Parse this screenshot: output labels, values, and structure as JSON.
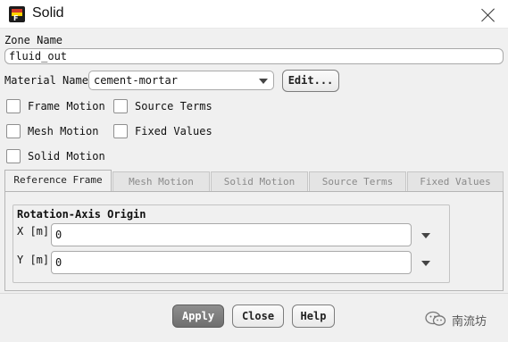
{
  "window": {
    "title": "Solid",
    "icon": "fluent-app-icon",
    "icon_letter": "F"
  },
  "zone": {
    "label": "Zone Name",
    "value": "fluid_out"
  },
  "material": {
    "label": "Material Name",
    "value": "cement-mortar",
    "edit_label": "Edit..."
  },
  "checkboxes": [
    {
      "label": "Frame Motion",
      "checked": false
    },
    {
      "label": "Source Terms",
      "checked": false
    },
    {
      "label": "Mesh Motion",
      "checked": false
    },
    {
      "label": "Fixed Values",
      "checked": false
    },
    {
      "label": "Solid Motion",
      "checked": false
    }
  ],
  "tabs": [
    {
      "label": "Reference Frame",
      "active": true
    },
    {
      "label": "Mesh Motion",
      "active": false
    },
    {
      "label": "Solid Motion",
      "active": false
    },
    {
      "label": "Source Terms",
      "active": false
    },
    {
      "label": "Fixed Values",
      "active": false
    }
  ],
  "rotation_origin": {
    "title": "Rotation-Axis Origin",
    "x_label": "X [m]",
    "x_value": "0",
    "y_label": "Y [m]",
    "y_value": "0"
  },
  "buttons": {
    "apply": "Apply",
    "close": "Close",
    "help": "Help"
  },
  "watermark": {
    "text": "南流坊",
    "icon": "wechat-icon"
  }
}
